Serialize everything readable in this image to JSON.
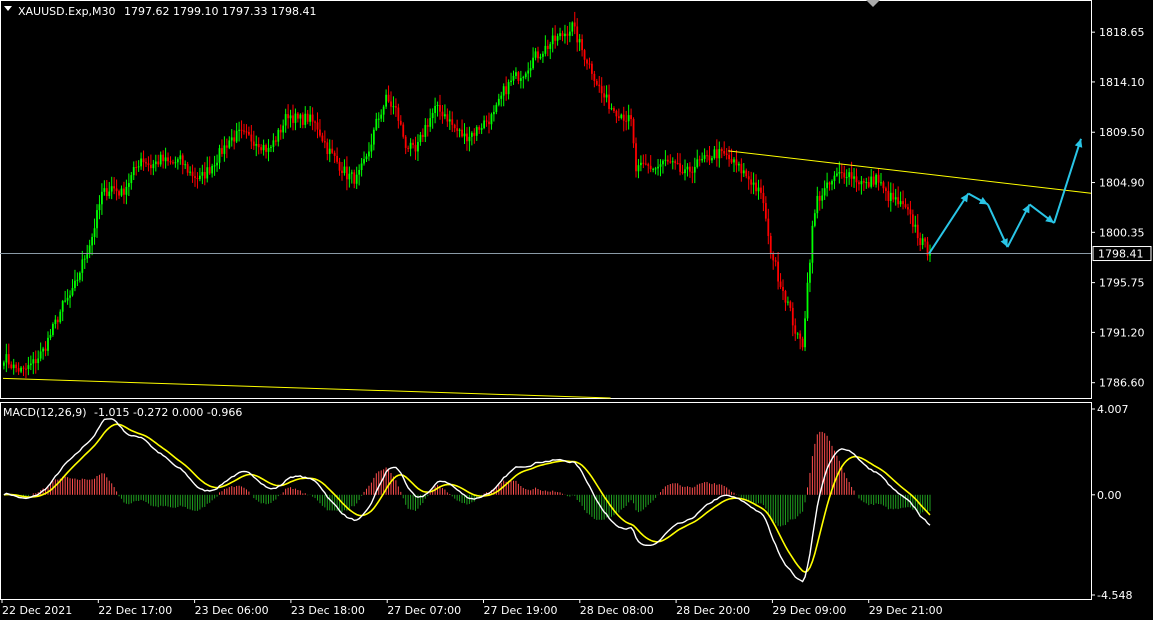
{
  "header": {
    "symbol": "XAUUSD.Exp,M30",
    "open": "1797.62",
    "high": "1799.10",
    "low": "1797.33",
    "close": "1798.41"
  },
  "macd": {
    "label": "MACD(12,26,9)",
    "values": "-1.015 -0.272 0.000 -0.966",
    "ticks": [
      "4.007",
      "0.00",
      "-4.548"
    ],
    "range": [
      -4.548,
      4.007
    ]
  },
  "price_axis": {
    "ticks": [
      "1818.65",
      "1814.10",
      "1809.50",
      "1804.90",
      "1800.35",
      "1795.75",
      "1791.20",
      "1786.60"
    ],
    "current": "1798.41",
    "range": [
      1785.2,
      1821.5
    ]
  },
  "time_axis": {
    "labels": [
      "22 Dec 2021",
      "22 Dec 17:00",
      "23 Dec 06:00",
      "23 Dec 18:00",
      "27 Dec 07:00",
      "27 Dec 19:00",
      "28 Dec 08:00",
      "28 Dec 20:00",
      "29 Dec 09:00",
      "29 Dec 21:00"
    ]
  },
  "colors": {
    "bull": "#00ff00",
    "bear": "#ff0000",
    "trendline": "#ffff00",
    "forecast": "#29c5e6",
    "macd_line": "#ffffff",
    "signal_line": "#ffff00",
    "hist_pos": "#ff4d4d",
    "hist_neg": "#1f9f1f",
    "frame": "#ffffff"
  },
  "chart_data": {
    "type": "candlestick",
    "title": "XAUUSD.Exp,M30",
    "ylim": [
      1785.2,
      1821.5
    ],
    "anchors": [
      [
        0,
        1789.0
      ],
      [
        4,
        1788.0
      ],
      [
        8,
        1787.6
      ],
      [
        12,
        1788.4
      ],
      [
        16,
        1789.5
      ],
      [
        20,
        1791.5
      ],
      [
        24,
        1793.6
      ],
      [
        28,
        1794.8
      ],
      [
        32,
        1797.5
      ],
      [
        36,
        1800.0
      ],
      [
        40,
        1803.8
      ],
      [
        44,
        1804.5
      ],
      [
        48,
        1803.9
      ],
      [
        52,
        1805.4
      ],
      [
        56,
        1807.2
      ],
      [
        60,
        1806.4
      ],
      [
        64,
        1807.0
      ],
      [
        68,
        1806.6
      ],
      [
        72,
        1806.9
      ],
      [
        76,
        1805.8
      ],
      [
        80,
        1805.2
      ],
      [
        84,
        1806.2
      ],
      [
        88,
        1807.5
      ],
      [
        92,
        1808.8
      ],
      [
        96,
        1809.3
      ],
      [
        100,
        1809.0
      ],
      [
        104,
        1808.6
      ],
      [
        108,
        1807.8
      ],
      [
        112,
        1809.3
      ],
      [
        116,
        1811.2
      ],
      [
        120,
        1810.6
      ],
      [
        124,
        1810.8
      ],
      [
        128,
        1810.0
      ],
      [
        132,
        1808.0
      ],
      [
        136,
        1806.8
      ],
      [
        140,
        1805.6
      ],
      [
        144,
        1805.2
      ],
      [
        148,
        1807.0
      ],
      [
        152,
        1810.3
      ],
      [
        156,
        1812.5
      ],
      [
        160,
        1811.5
      ],
      [
        164,
        1808.4
      ],
      [
        168,
        1807.6
      ],
      [
        172,
        1810.0
      ],
      [
        176,
        1811.6
      ],
      [
        180,
        1811.2
      ],
      [
        184,
        1809.8
      ],
      [
        188,
        1809.1
      ],
      [
        192,
        1809.5
      ],
      [
        196,
        1810.4
      ],
      [
        200,
        1811.0
      ],
      [
        204,
        1813.2
      ],
      [
        208,
        1814.4
      ],
      [
        212,
        1815.0
      ],
      [
        216,
        1816.2
      ],
      [
        220,
        1817.0
      ],
      [
        224,
        1817.8
      ],
      [
        228,
        1818.4
      ],
      [
        232,
        1819.2
      ],
      [
        236,
        1817.0
      ],
      [
        240,
        1815.2
      ],
      [
        244,
        1813.0
      ],
      [
        248,
        1811.8
      ],
      [
        252,
        1811.2
      ],
      [
        256,
        1810.4
      ],
      [
        258,
        1806.0
      ],
      [
        262,
        1806.4
      ],
      [
        266,
        1806.2
      ],
      [
        270,
        1806.8
      ],
      [
        274,
        1806.3
      ],
      [
        278,
        1805.6
      ],
      [
        282,
        1806.5
      ],
      [
        286,
        1806.9
      ],
      [
        290,
        1807.6
      ],
      [
        294,
        1807.4
      ],
      [
        298,
        1806.6
      ],
      [
        302,
        1805.8
      ],
      [
        306,
        1804.8
      ],
      [
        310,
        1803.2
      ],
      [
        312,
        1799.6
      ],
      [
        316,
        1796.4
      ],
      [
        320,
        1793.8
      ],
      [
        324,
        1790.6
      ],
      [
        326,
        1790.2
      ],
      [
        328,
        1795.6
      ],
      [
        330,
        1800.6
      ],
      [
        332,
        1803.4
      ],
      [
        336,
        1804.4
      ],
      [
        340,
        1805.5
      ],
      [
        344,
        1805.9
      ],
      [
        348,
        1805.2
      ],
      [
        352,
        1804.6
      ],
      [
        356,
        1805.4
      ],
      [
        360,
        1803.8
      ],
      [
        364,
        1803.2
      ],
      [
        368,
        1802.4
      ],
      [
        372,
        1800.8
      ],
      [
        374,
        1799.6
      ],
      [
        378,
        1798.41
      ]
    ],
    "forecast_path": [
      [
        378,
        1798.41
      ],
      [
        394,
        1803.9
      ],
      [
        402,
        1802.9
      ],
      [
        410,
        1799.0
      ],
      [
        419,
        1802.9
      ],
      [
        429,
        1801.2
      ],
      [
        440,
        1808.9
      ]
    ],
    "resistance_line": [
      [
        296,
        1807.8
      ],
      [
        445,
        1803.9
      ]
    ],
    "support_line": [
      [
        0,
        1787.0
      ],
      [
        248,
        1785.2
      ]
    ],
    "current_price": 1798.41
  }
}
